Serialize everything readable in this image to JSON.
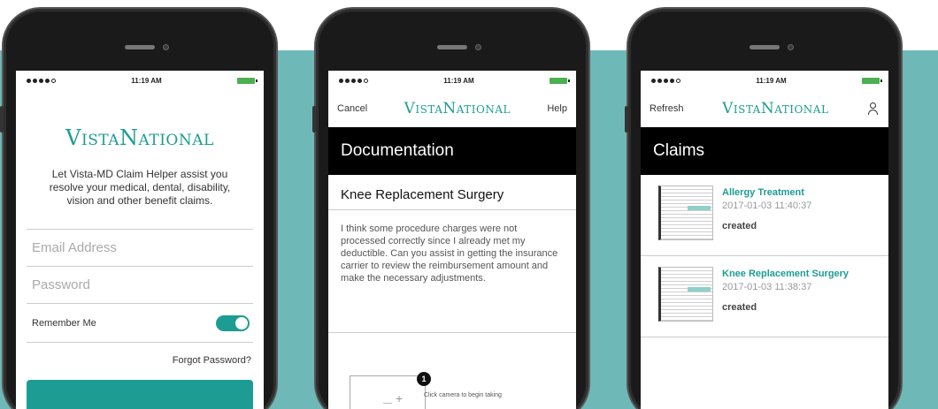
{
  "colors": {
    "teal_bg": "#6fb8b8",
    "brand": "#1d9c94",
    "banner": "#000000"
  },
  "status_bar": {
    "time": "11:19 AM"
  },
  "brand": {
    "logo_text": "VistaNational"
  },
  "login": {
    "intro": "Let  Vista-MD Claim Helper assist you resolve your medical, dental, disability, vision and other benefit claims.",
    "email_placeholder": "Email Address",
    "password_placeholder": "Password",
    "remember_label": "Remember Me",
    "remember_on": true,
    "forgot_label": "Forgot Password?"
  },
  "documentation": {
    "nav": {
      "left": "Cancel",
      "right": "Help"
    },
    "banner": "Documentation",
    "claim_title": "Knee Replacement Surgery",
    "description": "I think some procedure charges were not processed correctly since I already met my deductible. Can you assist in getting the insurance carrier to review the reimbursement amount and make the necessary adjustments.",
    "step_number": "1",
    "camera_hint": "Click camera to begin taking"
  },
  "claims": {
    "nav": {
      "left": "Refresh"
    },
    "banner": "Claims",
    "items": [
      {
        "name": "Allergy Treatment",
        "datetime": "2017-01-03  11:40:37",
        "status": "created"
      },
      {
        "name": "Knee Replacement Surgery",
        "datetime": "2017-01-03  11:38:37",
        "status": "created"
      }
    ]
  }
}
